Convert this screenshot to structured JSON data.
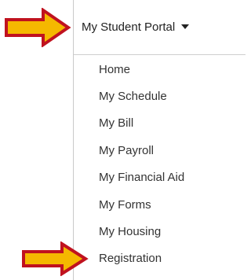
{
  "header": {
    "title": "My Student Portal",
    "caret_icon": "caret-down-icon"
  },
  "menu": {
    "items": [
      {
        "label": "Home"
      },
      {
        "label": "My Schedule"
      },
      {
        "label": "My Bill"
      },
      {
        "label": "My Payroll"
      },
      {
        "label": "My Financial Aid"
      },
      {
        "label": "My Forms"
      },
      {
        "label": "My Housing"
      },
      {
        "label": "Registration"
      }
    ]
  },
  "annotations": {
    "arrow_fill": "#f5b800",
    "arrow_stroke": "#c0121f"
  }
}
